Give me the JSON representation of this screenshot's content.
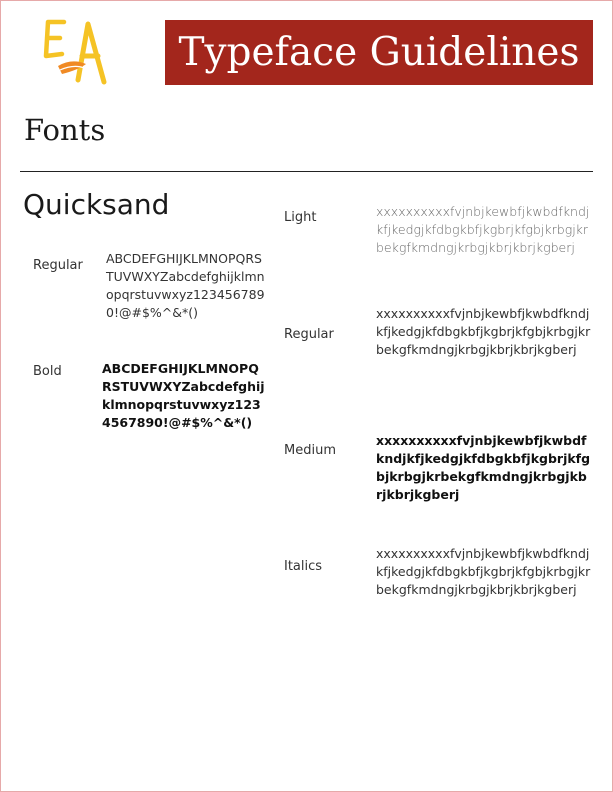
{
  "header": {
    "logo_text": "EA",
    "title": "Typeface Guidelines"
  },
  "section": {
    "heading": "Fonts"
  },
  "font": {
    "name": "Quicksand",
    "left_samples": [
      {
        "label": "Regular",
        "sample": "ABCDEFGHIJKLMNOPQRSTUVWXYZabcdefghijklmnopqrstuvwxyz1234567890!@#$%^&*()"
      },
      {
        "label": "Bold",
        "sample": "ABCDEFGHIJKLMNOPQRSTUVWXYZabcdefghijklmnopqrstuvwxyz1234567890!@#$%^&*()"
      }
    ],
    "right_samples": [
      {
        "label": "Light",
        "sample": "xxxxxxxxxxfvjnbjkewbfjkwbdfkndjkfjkedgjkfdbgkbfjkgbrjkfgbjkrbgjkrbekgfkmdngjkrbgjkbrjkbrjkgberj"
      },
      {
        "label": "Regular",
        "sample": "xxxxxxxxxxfvjnbjkewbfjkwbdfkndjkfjkedgjkfdbgkbfjkgbrjkfgbjkrbgjkrbekgfkmdngjkrbgjkbrjkbrjkgberj"
      },
      {
        "label": "Medium",
        "sample": "xxxxxxxxxxfvjnbjkewbfjkwbdfkndjkfjkedgjkfdbgkbfjkgbrjkfgbjkrbgjkrbekgfkmdngjkrbgjkbrjkbrjkgberj"
      },
      {
        "label": "Italics",
        "sample": "xxxxxxxxxxfvjnbjkewbfjkwbdfkndjkfjkedgjkfdbgkbfjkgbrjkfgbjkrbgjkrbekgfkmdngjkrbgjkbrjkbrjkgberj"
      }
    ]
  },
  "colors": {
    "banner": "#a3261c",
    "logo_yellow": "#f5c325",
    "logo_orange": "#f08a24",
    "border": "#e6a9a9"
  }
}
